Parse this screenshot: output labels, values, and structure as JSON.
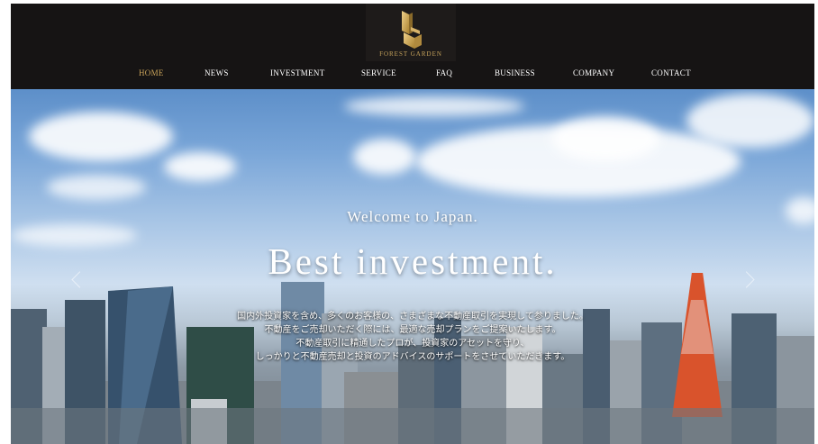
{
  "logo": {
    "text": "FOREST GARDEN",
    "icon": "building-logo-icon"
  },
  "nav": {
    "items": [
      "HOME",
      "NEWS",
      "INVESTMENT",
      "SERVICE",
      "FAQ",
      "BUSINESS",
      "COMPANY",
      "CONTACT"
    ],
    "active": "HOME"
  },
  "hero": {
    "welcome": "Welcome to Japan.",
    "headline": "Best investment.",
    "description": [
      "国内外投資家を含め、多くのお客様の、さまざまな不動産取引を実現して参りました。",
      "不動産をご売却いただく際には、最適な売却プランをご提案いたします。",
      "不動産取引に精通したプロが、投資家のアセットを守り、",
      "しっかりと不動産売却と投資のアドバイスのサポートをさせていただきます。"
    ],
    "prev_icon": "chevron-left-icon",
    "next_icon": "chevron-right-icon"
  },
  "colors": {
    "header_bg": "#161414",
    "accent_gold": "#c9a35a",
    "nav_text": "#ffffff"
  }
}
